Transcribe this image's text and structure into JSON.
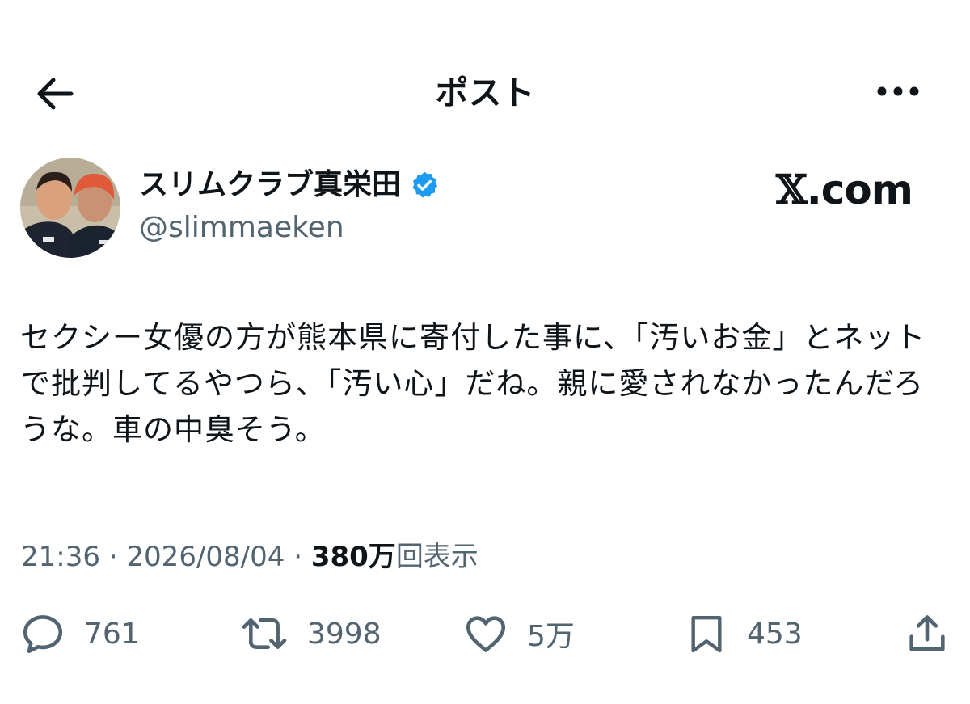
{
  "header": {
    "title": "ポスト",
    "back_icon": "arrow-left-icon",
    "more_icon": "more-horizontal-icon"
  },
  "author": {
    "display_name": "スリムクラブ真栄田",
    "handle": "@slimmaeken",
    "verified": true,
    "verified_color": "#1d9bf0"
  },
  "brand": {
    "x_glyph": "𝕏",
    "suffix": ".com"
  },
  "tweet": {
    "text": "セクシー女優の方が熊本県に寄付した事に、「汚いお金」とネットで批判してるやつら、「汚い心」だね。親に愛されなかったんだろうな。車の中臭そう。"
  },
  "meta": {
    "time": "21:36",
    "sep1": " · ",
    "date": "2026/08/04",
    "sep2": " · ",
    "views_count": "380万",
    "views_label": "回表示"
  },
  "actions": {
    "reply_count": "761",
    "retweet_count": "3998",
    "like_count": "5万",
    "bookmark_count": "453"
  },
  "colors": {
    "text_primary": "#0f1419",
    "text_secondary": "#536471",
    "accent": "#1d9bf0"
  }
}
